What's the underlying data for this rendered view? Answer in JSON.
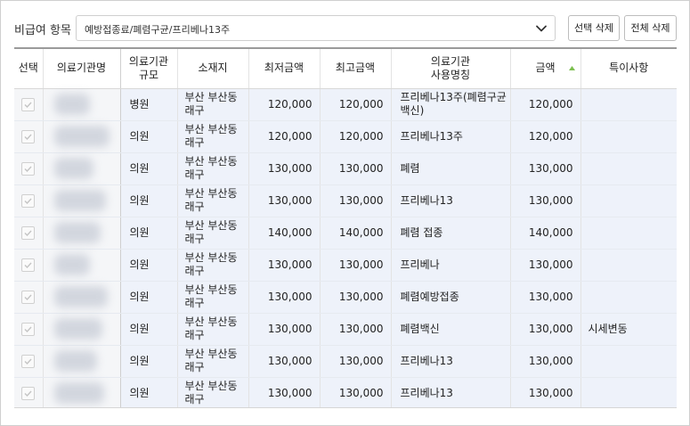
{
  "toolbar": {
    "label": "비급여 항목",
    "select_value": "예방접종료/폐렴구균/프리베나13주",
    "btn_delete_selected": "선택 삭제",
    "btn_delete_all": "전체 삭제"
  },
  "table": {
    "headers": {
      "select": "선택",
      "name": "의료기관명",
      "scale_l1": "의료기관",
      "scale_l2": "규모",
      "location": "소재지",
      "min": "최저금액",
      "max": "최고금액",
      "usename_l1": "의료기관",
      "usename_l2": "사용명칭",
      "amount": "금액",
      "note": "특이사항"
    },
    "sort": {
      "column": "amount",
      "direction": "ascending"
    },
    "rows": [
      {
        "checked": true,
        "scale": "병원",
        "loc1": "부산 부산동",
        "loc2": "래구",
        "min": "120,000",
        "max": "120,000",
        "use1": "프리베나13주(폐렴구균",
        "use2": "백신)",
        "amount": "120,000",
        "note": ""
      },
      {
        "checked": true,
        "scale": "의원",
        "loc1": "부산 부산동",
        "loc2": "래구",
        "min": "120,000",
        "max": "120,000",
        "use1": "프리베나13주",
        "use2": "",
        "amount": "120,000",
        "note": ""
      },
      {
        "checked": true,
        "scale": "의원",
        "loc1": "부산 부산동",
        "loc2": "래구",
        "min": "130,000",
        "max": "130,000",
        "use1": "폐렴",
        "use2": "",
        "amount": "130,000",
        "note": ""
      },
      {
        "checked": true,
        "scale": "의원",
        "loc1": "부산 부산동",
        "loc2": "래구",
        "min": "130,000",
        "max": "130,000",
        "use1": "프리베나13",
        "use2": "",
        "amount": "130,000",
        "note": ""
      },
      {
        "checked": true,
        "scale": "의원",
        "loc1": "부산 부산동",
        "loc2": "래구",
        "min": "140,000",
        "max": "140,000",
        "use1": "폐렴 접종",
        "use2": "",
        "amount": "140,000",
        "note": ""
      },
      {
        "checked": true,
        "scale": "의원",
        "loc1": "부산 부산동",
        "loc2": "래구",
        "min": "130,000",
        "max": "130,000",
        "use1": "프리베나",
        "use2": "",
        "amount": "130,000",
        "note": ""
      },
      {
        "checked": true,
        "scale": "의원",
        "loc1": "부산 부산동",
        "loc2": "래구",
        "min": "130,000",
        "max": "130,000",
        "use1": "폐렴예방접종",
        "use2": "",
        "amount": "130,000",
        "note": ""
      },
      {
        "checked": true,
        "scale": "의원",
        "loc1": "부산 부산동",
        "loc2": "래구",
        "min": "130,000",
        "max": "130,000",
        "use1": "폐렴백신",
        "use2": "",
        "amount": "130,000",
        "note": "시세변동"
      },
      {
        "checked": true,
        "scale": "의원",
        "loc1": "부산 부산동",
        "loc2": "래구",
        "min": "130,000",
        "max": "130,000",
        "use1": "프리베나13",
        "use2": "",
        "amount": "130,000",
        "note": ""
      },
      {
        "checked": true,
        "scale": "의원",
        "loc1": "부산 부산동",
        "loc2": "래구",
        "min": "130,000",
        "max": "130,000",
        "use1": "프리베나13",
        "use2": "",
        "amount": "130,000",
        "note": ""
      }
    ]
  },
  "colors": {
    "row_bg": "#eef2fa",
    "sort_arrow": "#7cbf4f",
    "border": "#cfcfcf"
  },
  "icons": {
    "dropdown": "chevron-down-icon",
    "sort": "sort-ascending-icon",
    "checkbox": "checkmark-icon"
  }
}
